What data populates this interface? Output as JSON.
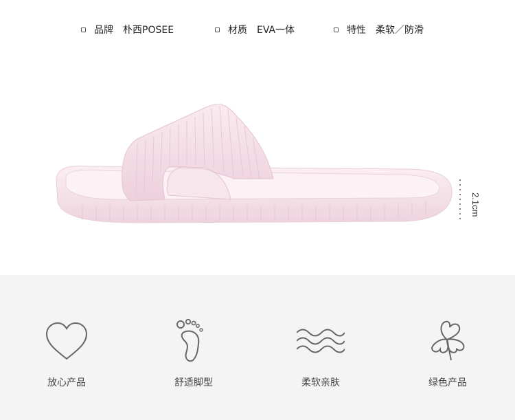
{
  "specs": [
    {
      "label": "品牌",
      "value": "朴西POSEE"
    },
    {
      "label": "材质",
      "value": "EVA一体"
    },
    {
      "label": "特性",
      "value": "柔软／防滑"
    }
  ],
  "product": {
    "height_label": "2.1cm",
    "color": "#f5dde6"
  },
  "features": [
    {
      "icon": "heart-icon",
      "label": "放心产品"
    },
    {
      "icon": "foot-icon",
      "label": "舒适脚型"
    },
    {
      "icon": "waves-icon",
      "label": "柔软亲肤"
    },
    {
      "icon": "clover-icon",
      "label": "绿色产品"
    }
  ]
}
